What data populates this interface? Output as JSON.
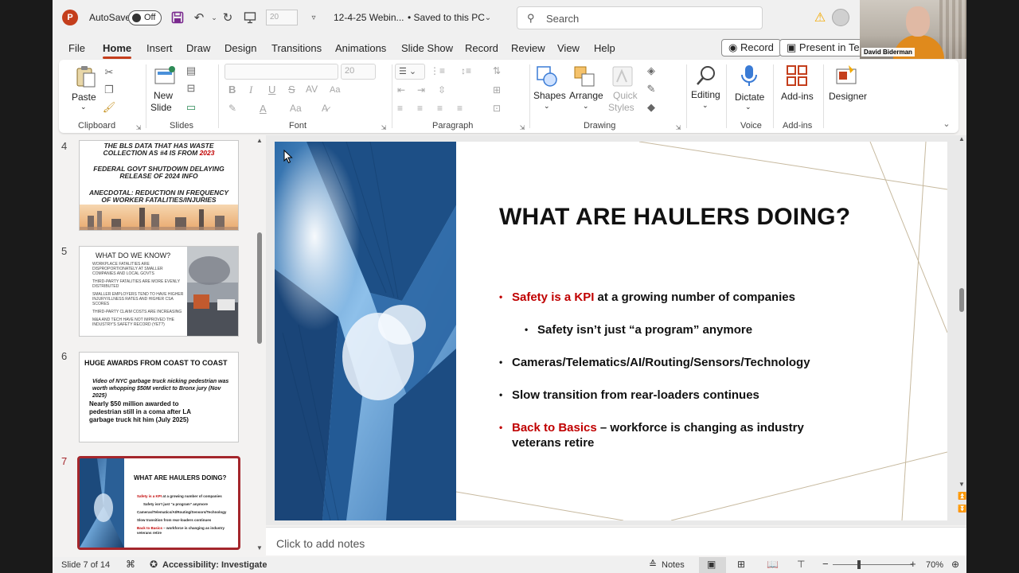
{
  "titlebar": {
    "app_letter": "P",
    "autosave_label": "AutoSave",
    "autosave_state": "Off",
    "font_size_mini": "20",
    "document_name": "12-4-25 Webin...",
    "save_status": "• Saved to this PC",
    "search_placeholder": "Search"
  },
  "webcam": {
    "name": "David Biderman"
  },
  "menu": {
    "tabs": [
      "File",
      "Home",
      "Insert",
      "Draw",
      "Design",
      "Transitions",
      "Animations",
      "Slide Show",
      "Record",
      "Review",
      "View",
      "Help"
    ],
    "active_tab": "Home",
    "record_button": "Record",
    "present_button": "Present in Tear"
  },
  "ribbon": {
    "clipboard": {
      "label": "Clipboard",
      "paste": "Paste"
    },
    "slides": {
      "label": "Slides",
      "new_slide_line1": "New",
      "new_slide_line2": "Slide"
    },
    "font": {
      "label": "Font",
      "size": "20"
    },
    "paragraph": {
      "label": "Paragraph"
    },
    "drawing": {
      "label": "Drawing",
      "shapes": "Shapes",
      "arrange": "Arrange",
      "quick_styles_line1": "Quick",
      "quick_styles_line2": "Styles"
    },
    "editing": {
      "label": "Editing"
    },
    "voice": {
      "label": "Voice",
      "dictate": "Dictate"
    },
    "addins": {
      "label": "Add-ins",
      "addins": "Add-ins"
    },
    "designer": {
      "label": "Designer"
    }
  },
  "thumbnails": [
    {
      "number": "4",
      "lines": [
        {
          "text": "THE BLS DATA THAT HAS WASTE"
        },
        {
          "text": "COLLECTION AS #4 IS FROM ",
          "red": "2023"
        },
        {
          "text": "FEDERAL GOVT SHUTDOWN DELAYING"
        },
        {
          "text": "RELEASE OF 2024 INFO"
        },
        {
          "text": "ANECDOTAL: REDUCTION IN FREQUENCY"
        },
        {
          "text": "OF WORKER FATALITIES/INJURIES"
        }
      ]
    },
    {
      "number": "5",
      "title": "WHAT DO WE KNOW?",
      "items": [
        "WORKPLACE FATALITIES ARE DISPROPORTIONATELY AT SMALLER COMPANIES AND LOCAL GOVTS",
        "THIRD-PARTY FATALITIES ARE MORE EVENLY DISTRIBUTED",
        "SMALLER EMPLOYERS TEND TO HAVE HIGHER INJURY/ILLNESS RATES AND HIGHER CSA SCORES",
        "THIRD-PARTY CLAIM COSTS ARE INCREASING",
        "M&A AND TECH HAVE NOT IMPROVED THE INDUSTRY'S SAFETY RECORD (YET?)"
      ]
    },
    {
      "number": "6",
      "title": "HUGE AWARDS FROM COAST TO COAST",
      "item1": "Video of NYC garbage truck nicking pedestrian was worth whopping $50M verdict to Bronx jury (Nov 2025)",
      "item2": "Nearly $50 million awarded to pedestrian still in a coma after LA garbage truck hit him (July 2025)"
    },
    {
      "number": "7",
      "title": "WHAT ARE HAULERS DOING?"
    }
  ],
  "slide": {
    "title": "WHAT ARE HAULERS DOING?",
    "b1_red": "Safety is a KPI",
    "b1_rest": " at a growing number of companies",
    "b1_sub": "Safety isn’t just “a program” anymore",
    "b2": "Cameras/Telematics/AI/Routing/Sensors/Technology",
    "b3": "Slow transition from rear-loaders continues",
    "b4_red": "Back to Basics",
    "b4_rest": " – workforce is changing as industry veterans retire"
  },
  "notes_placeholder": "Click to add notes",
  "status": {
    "slide_info": "Slide 7 of 14",
    "accessibility": "Accessibility: Investigate",
    "notes_button": "Notes",
    "zoom": "70%",
    "zoom_level": 0.7
  },
  "colors": {
    "accent": "#c43e1c",
    "selection": "#a4262c",
    "slide_red": "#c00000"
  }
}
